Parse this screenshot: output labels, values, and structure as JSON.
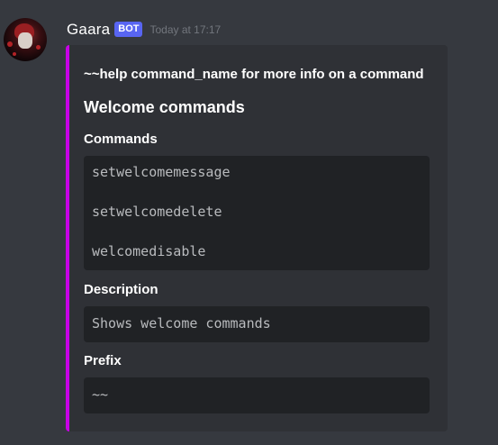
{
  "message": {
    "username": "Gaara",
    "bot_tag": "BOT",
    "timestamp": "Today at 17:17"
  },
  "embed": {
    "accent_color": "#c800e6",
    "author": "~~help command_name for more info on a command",
    "title": "Welcome commands",
    "fields": [
      {
        "name": "Commands",
        "lines": [
          "setwelcomemessage",
          "setwelcomedelete",
          "welcomedisable"
        ]
      },
      {
        "name": "Description",
        "lines": [
          "Shows welcome commands"
        ]
      },
      {
        "name": "Prefix",
        "lines": [
          "~~"
        ]
      }
    ]
  },
  "colors": {
    "background": "#36393f",
    "embed_background": "#2f3136",
    "code_background": "#202225",
    "bot_tag": "#5865f2"
  }
}
